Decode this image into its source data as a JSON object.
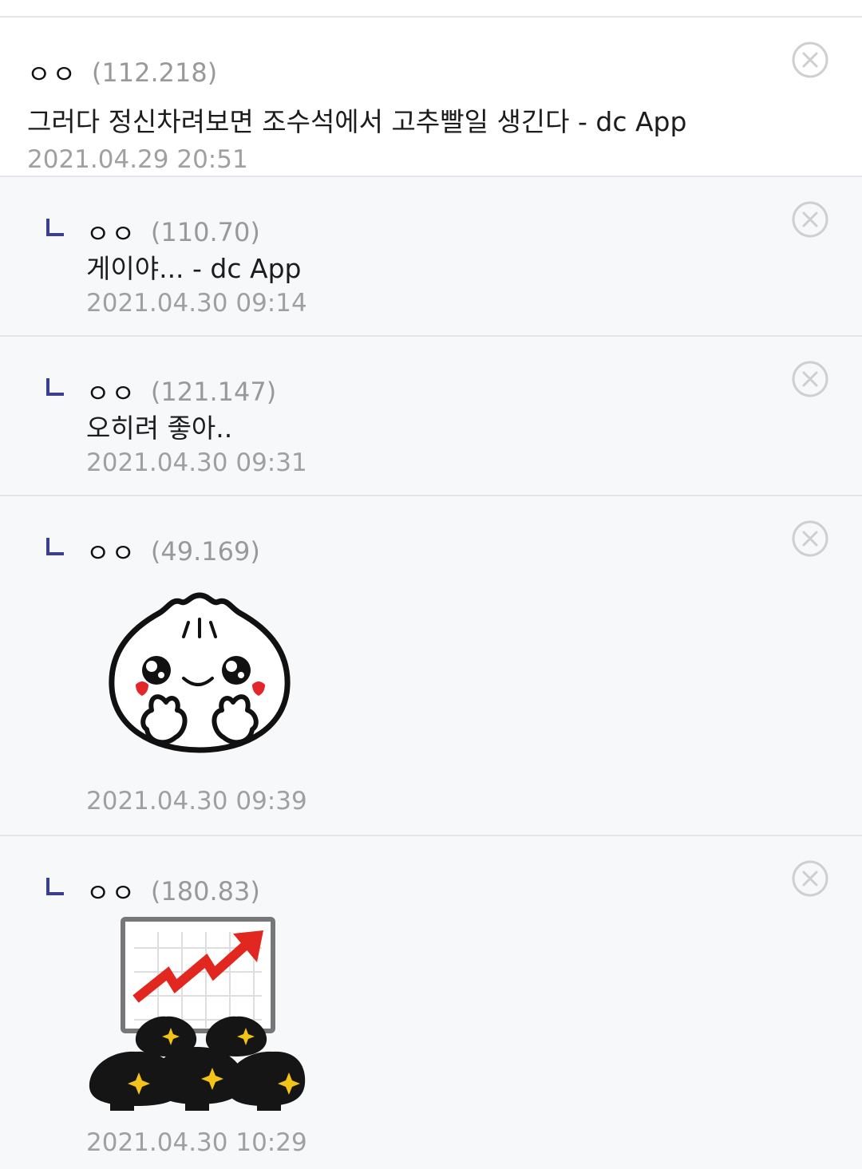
{
  "comments": [
    {
      "nick": "ㅇㅇ",
      "ip": "(112.218)",
      "text": "그러다 정신차려보면 조수석에서 고추빨일 생긴다 - dc App",
      "date": "2021.04.29 20:51"
    },
    {
      "nick": "ㅇㅇ",
      "ip": "(110.70)",
      "text": "게이야... - dc App",
      "date": "2021.04.30 09:14"
    },
    {
      "nick": "ㅇㅇ",
      "ip": "(121.147)",
      "text": "오히려 좋아..",
      "date": "2021.04.30 09:31"
    },
    {
      "nick": "ㅇㅇ",
      "ip": "(49.169)",
      "sticker": "dumpling-heart-sticker",
      "date": "2021.04.30 09:39"
    },
    {
      "nick": "ㅇㅇ",
      "ip": "(180.83)",
      "sticker": "dumplings-chart-rising-sticker",
      "date": "2021.04.30 10:29"
    }
  ],
  "icons": {
    "reply": "reply-arrow-icon",
    "delete": "close-circle-icon"
  },
  "colors": {
    "reply_bg": "#f7f8fa",
    "reply_mark": "#3b3f8f",
    "chart_arrow": "#e1271f"
  }
}
